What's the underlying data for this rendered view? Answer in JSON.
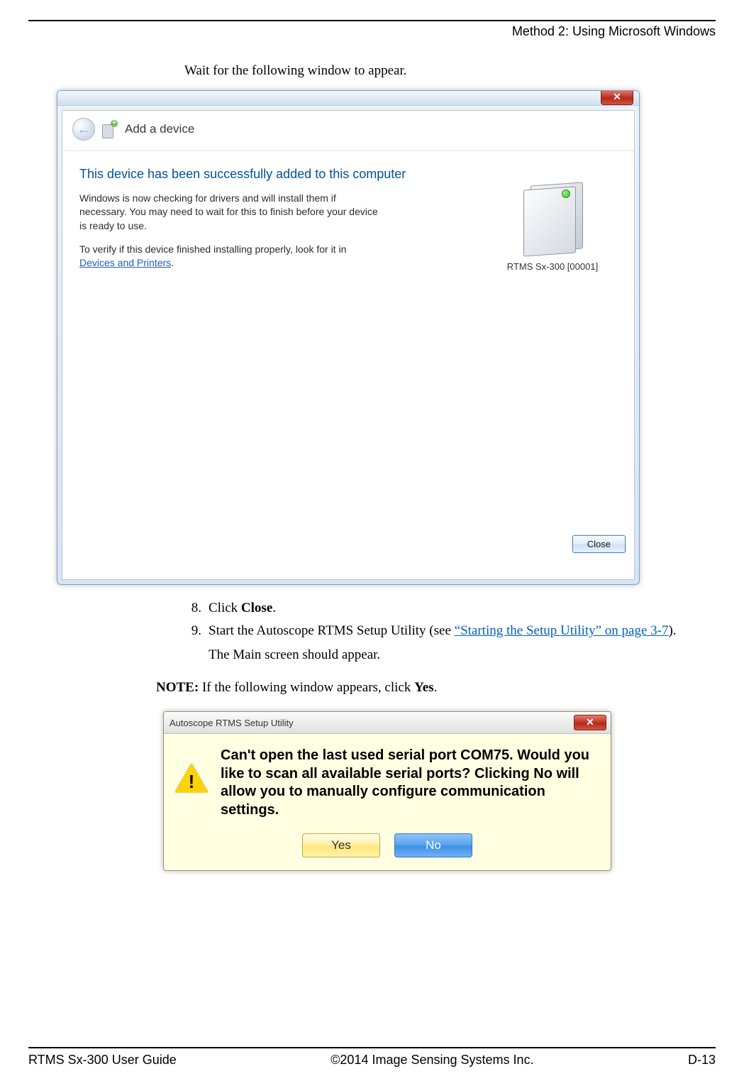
{
  "header": {
    "section": "Method 2: Using Microsoft Windows"
  },
  "intro": "Wait for the following window to appear.",
  "win1": {
    "nav_title": "Add a device",
    "back_arrow": "←",
    "close_glyph": "✕",
    "heading": "This device has been successfully added to this computer",
    "para1": "Windows is now checking for drivers and will install them if necessary. You may need to wait for this to finish before your device is ready to use.",
    "para2_pre": "To verify if this device finished installing properly, look for it in ",
    "para2_link": "Devices and Printers",
    "para2_post": ".",
    "device_label": "RTMS Sx-300 [00001]",
    "close_button": "Close"
  },
  "steps": {
    "s8_num": "8.",
    "s8_a": "Click ",
    "s8_b": "Close",
    "s8_c": ".",
    "s9_num": "9.",
    "s9_a": "Start the Autoscope RTMS Setup Utility (see ",
    "s9_link": "“Starting the Setup Utility” on page 3-7",
    "s9_b": ").",
    "s9_follow": "The Main screen should appear."
  },
  "note": {
    "label": "NOTE:",
    "a": "  If the following window appears, click ",
    "b": "Yes",
    "c": "."
  },
  "win2": {
    "title": "Autoscope RTMS Setup Utility",
    "close_glyph": "✕",
    "warn_mark": "!",
    "msg": "Can't open the last used serial port COM75. Would you like to scan all available serial ports? Clicking No will allow you to manually configure communication settings.",
    "yes": "Yes",
    "no": "No"
  },
  "footer": {
    "left": "RTMS Sx-300 User Guide",
    "center": "©2014 Image Sensing Systems Inc.",
    "right": "D-13"
  }
}
